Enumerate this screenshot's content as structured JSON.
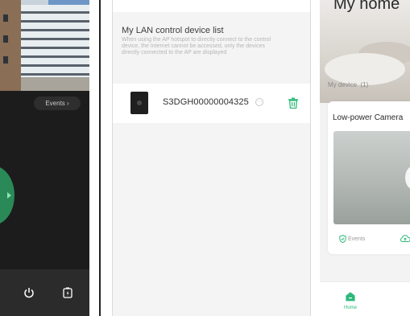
{
  "live_view": {
    "events_button": "Events ›",
    "icons": [
      "power-icon",
      "battery-charge-icon"
    ]
  },
  "lan_list": {
    "title": "My LAN control device list",
    "description": "When using the AP hotspot to directly connect to the control device, the Internet cannot be accessed, only the devices directly connected to the AP are displayed",
    "devices": [
      {
        "name": "S3DGH00000004325"
      }
    ]
  },
  "home": {
    "title": "My home",
    "device_count": "My device  (1)",
    "device_card": {
      "title": "Low-power Camera",
      "events_label": "Events"
    },
    "nav": {
      "home_label": "Home"
    }
  },
  "colors": {
    "accent_green": "#2db97a",
    "dark_bg": "#1c1c1c",
    "ptz_green": "#2a8a57"
  }
}
